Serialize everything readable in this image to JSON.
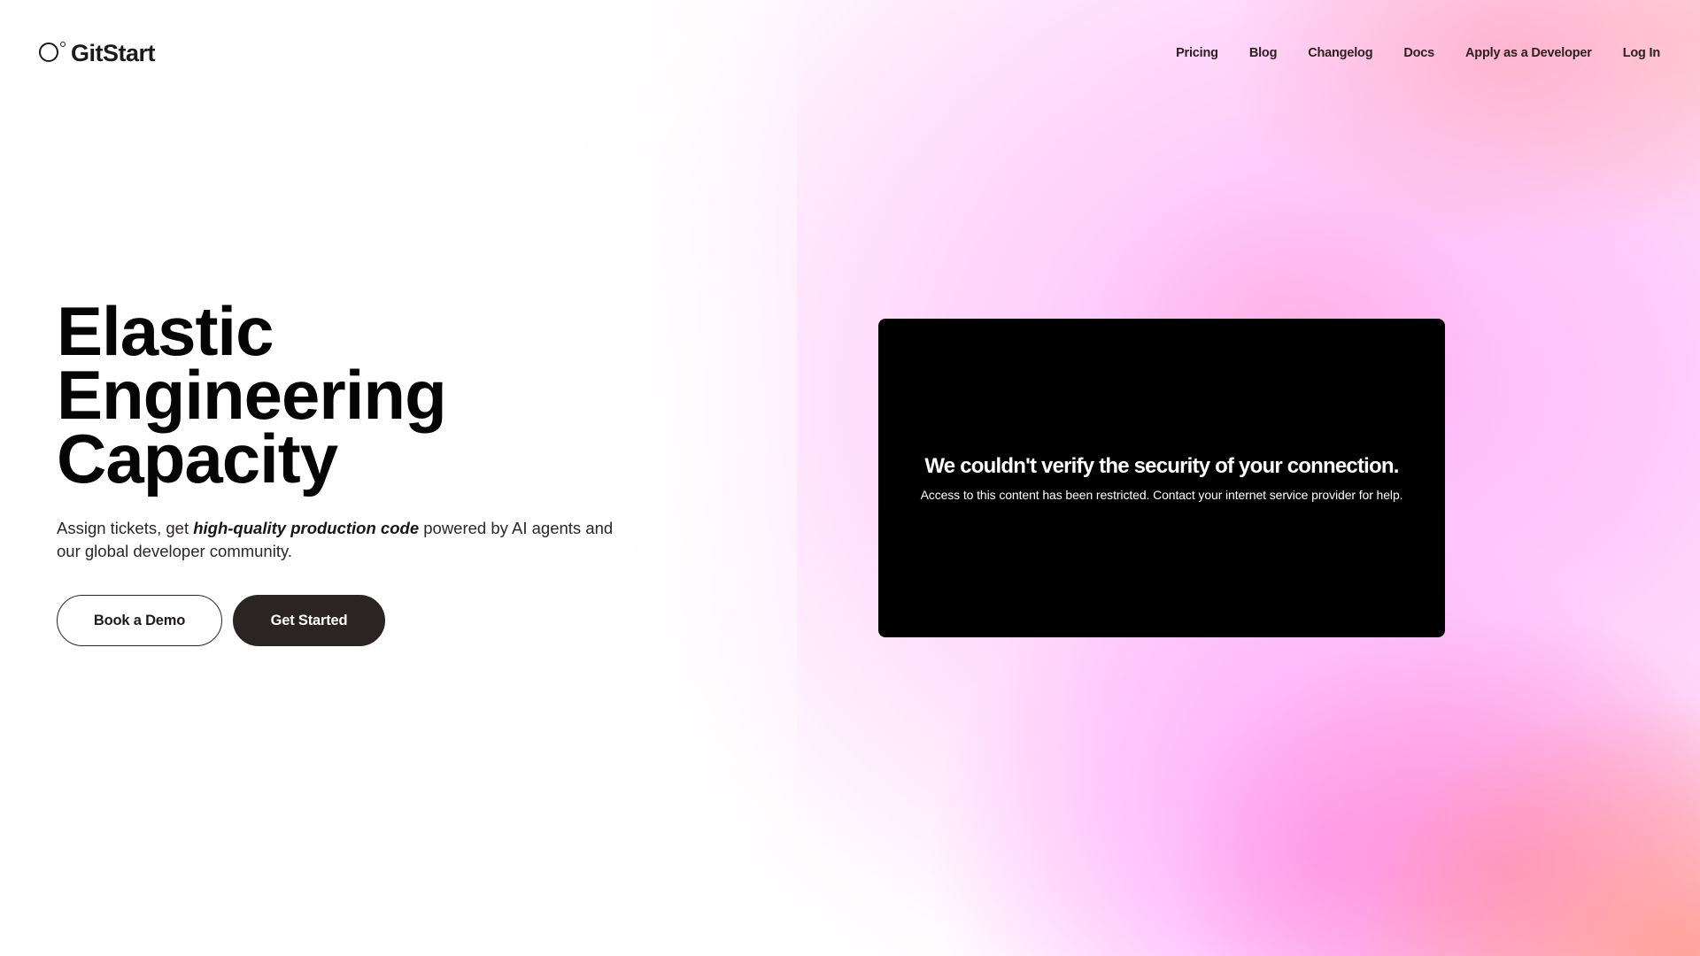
{
  "header": {
    "logo_text": "GitStart",
    "nav": [
      {
        "label": "Pricing"
      },
      {
        "label": "Blog"
      },
      {
        "label": "Changelog"
      },
      {
        "label": "Docs"
      },
      {
        "label": "Apply as a Developer"
      },
      {
        "label": "Log In"
      }
    ]
  },
  "hero": {
    "title_lines": [
      "Elastic",
      "Engineering",
      "Capacity"
    ],
    "subtitle_prefix": "Assign tickets, get ",
    "subtitle_emphasis": "high-quality production code",
    "subtitle_suffix": " powered by AI agents and our global developer community.",
    "buttons": {
      "book_demo": "Book a Demo",
      "get_started": "Get Started"
    }
  },
  "embed": {
    "error_title": "We couldn't verify the security of your connection.",
    "error_message": "Access to this content has been restricted. Contact your internet service provider for help."
  },
  "colors": {
    "primary_button": "#2a2524",
    "text": "#0b0b0b",
    "gradient_pink": "#ff9cf5",
    "gradient_coral": "#ffa096"
  }
}
